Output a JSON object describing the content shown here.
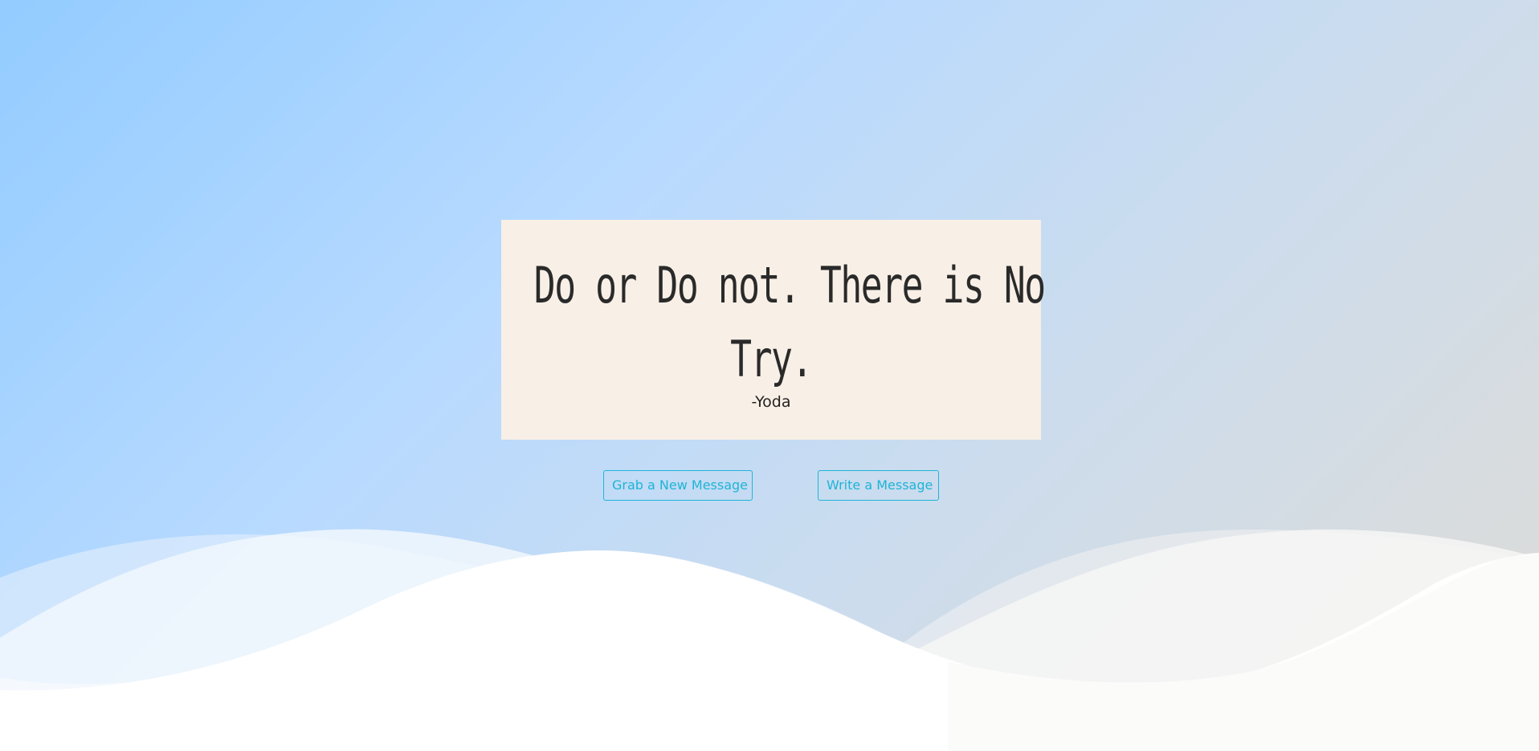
{
  "quote": {
    "line1": "Do or Do not. There is No",
    "line2": "Try.",
    "author": "-Yoda"
  },
  "actions": {
    "grab_label": "Grab a New Message",
    "write_label": "Write a Message"
  },
  "colors": {
    "card_background": "#f8efe6",
    "button_accent": "#1fb4d6",
    "text": "#2a2a2a"
  }
}
